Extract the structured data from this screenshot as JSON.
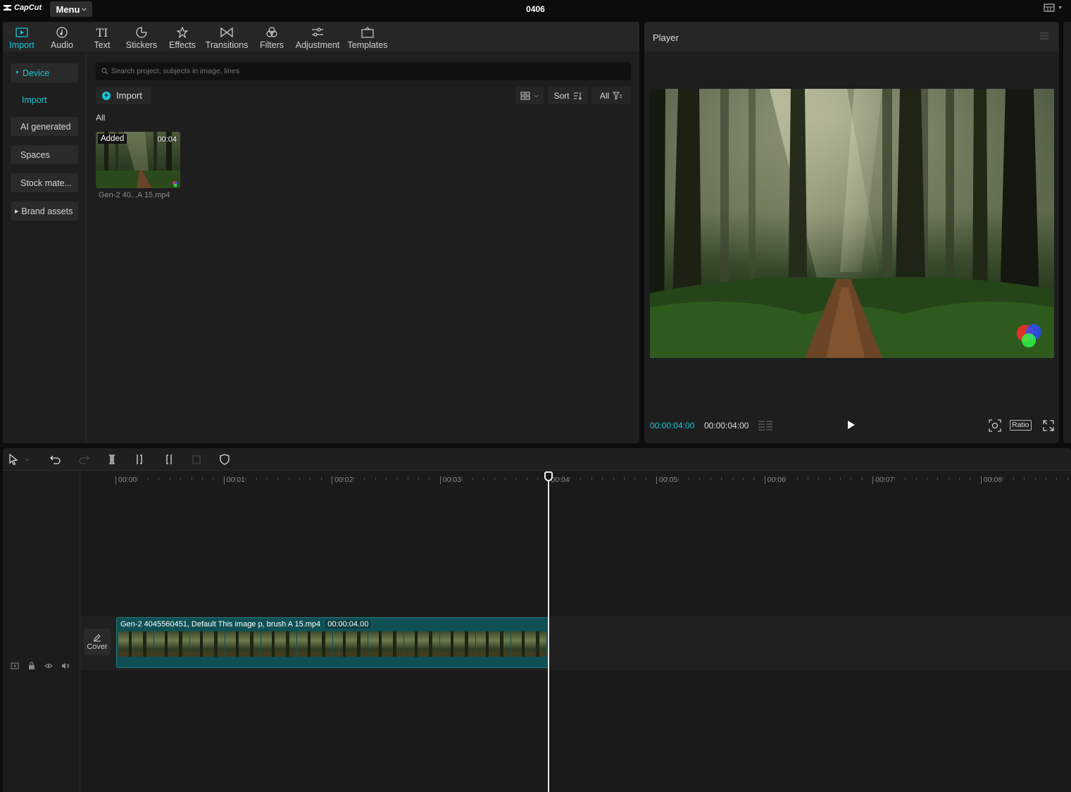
{
  "app": {
    "name": "CapCut",
    "menu_label": "Menu",
    "project_title": "0406"
  },
  "toolbar_tabs": [
    {
      "label": "Import",
      "icon": "import-icon",
      "active": true
    },
    {
      "label": "Audio",
      "icon": "audio-icon"
    },
    {
      "label": "Text",
      "icon": "text-icon"
    },
    {
      "label": "Stickers",
      "icon": "sticker-icon"
    },
    {
      "label": "Effects",
      "icon": "effects-icon"
    },
    {
      "label": "Transitions",
      "icon": "transitions-icon"
    },
    {
      "label": "Filters",
      "icon": "filters-icon"
    },
    {
      "label": "Adjustment",
      "icon": "adjustment-icon"
    },
    {
      "label": "Templates",
      "icon": "templates-icon"
    }
  ],
  "side_nav": {
    "device": "Device",
    "import": "Import",
    "ai_generated": "AI generated",
    "spaces": "Spaces",
    "stock": "Stock mate...",
    "brand": "Brand assets"
  },
  "media": {
    "search_placeholder": "Search project, subjects in image, lines",
    "import_label": "Import",
    "sort_label": "Sort",
    "filter_label": "All",
    "section_label": "All",
    "items": [
      {
        "badge": "Added",
        "duration": "00:04",
        "name": "Gen-2 40...A 15.mp4"
      }
    ]
  },
  "player": {
    "title": "Player",
    "current_time": "00:00:04:00",
    "total_time": "00:00:04:00",
    "ratio_label": "Ratio"
  },
  "timeline": {
    "ruler": [
      "00:00",
      "00:01",
      "00:02",
      "00:03",
      "00:04",
      "00:05",
      "00:06",
      "00:07",
      "00:08"
    ],
    "clip": {
      "name": "Gen-2 4045560451, Default  This  image  p, brush  A 15.mp4",
      "duration": "00:00:04.00"
    },
    "cover_label": "Cover"
  },
  "colors": {
    "accent": "#19c6d9",
    "clip": "#0f5054",
    "panel": "#1e1e1e"
  }
}
